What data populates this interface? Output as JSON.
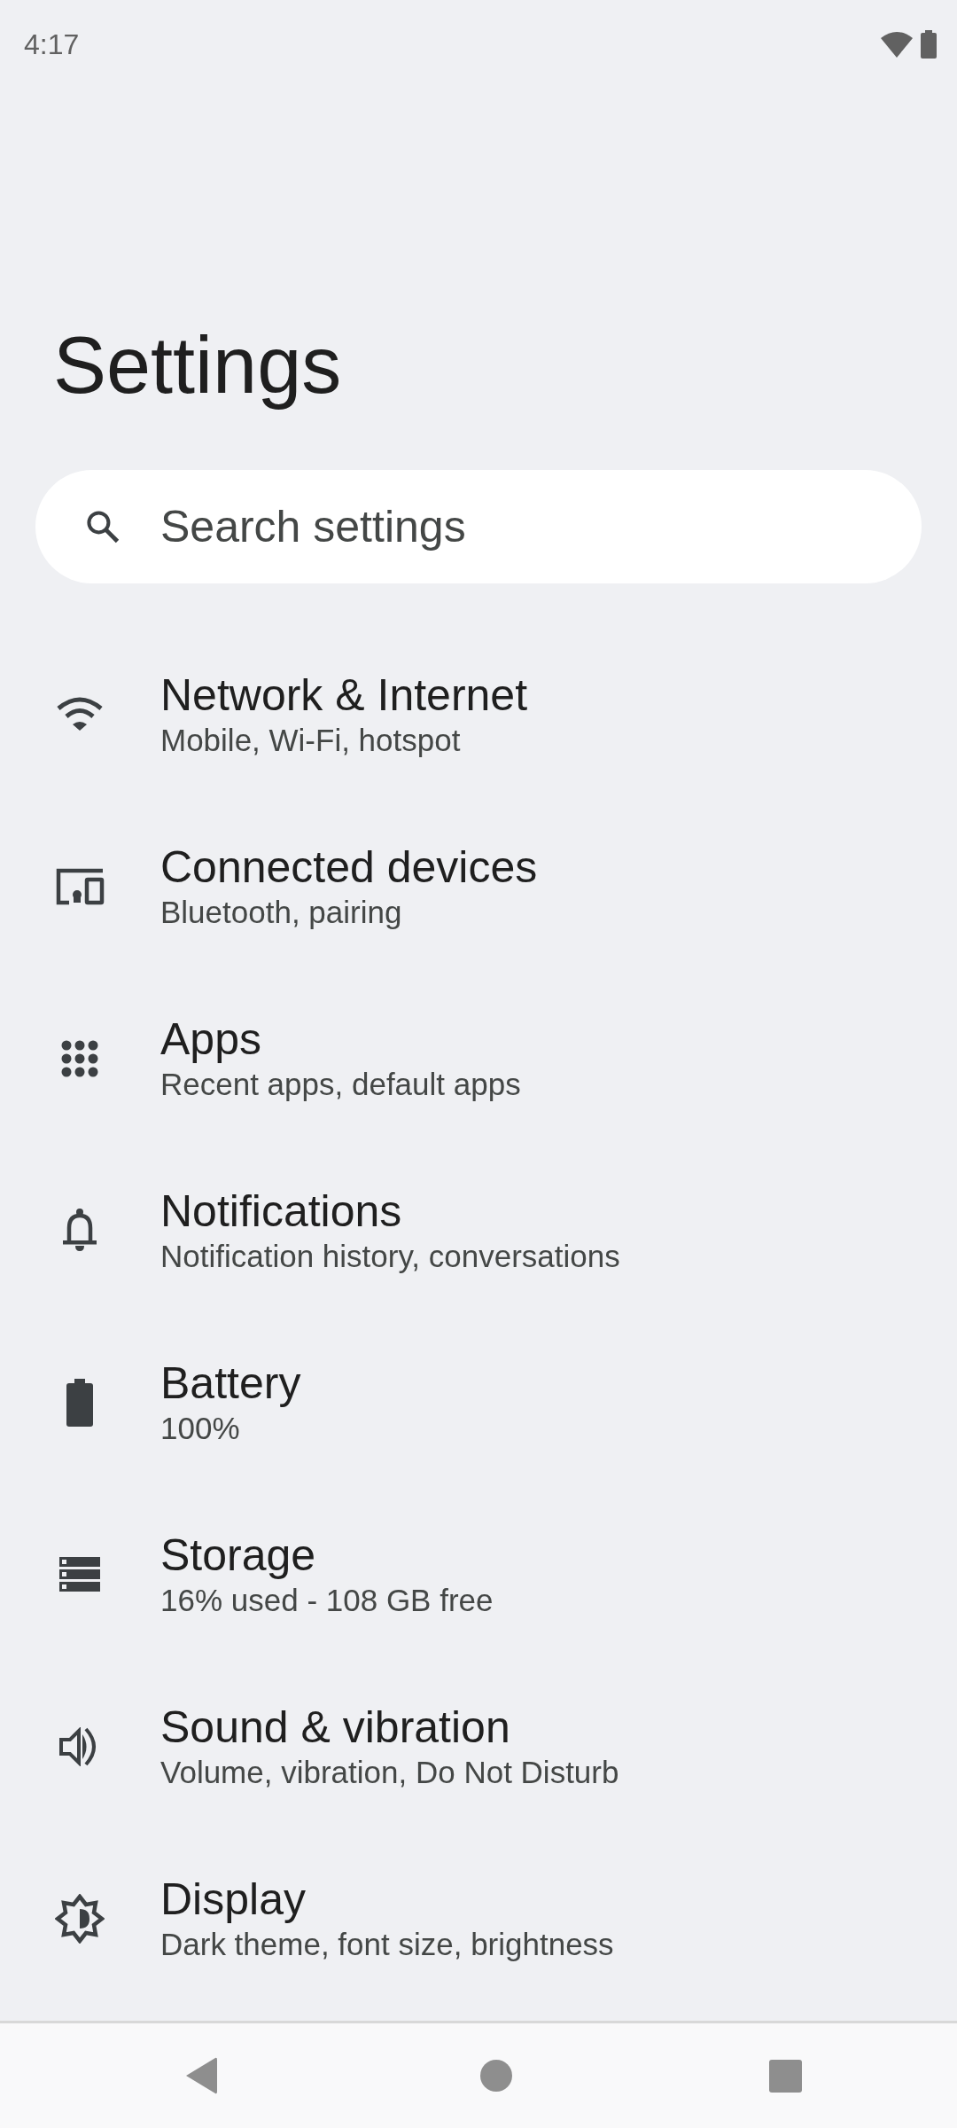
{
  "status_bar": {
    "time": "4:17"
  },
  "title": "Settings",
  "search": {
    "placeholder": "Search settings"
  },
  "items": [
    {
      "title": "Network & Internet",
      "subtitle": "Mobile, Wi-Fi, hotspot"
    },
    {
      "title": "Connected devices",
      "subtitle": "Bluetooth, pairing"
    },
    {
      "title": "Apps",
      "subtitle": "Recent apps, default apps"
    },
    {
      "title": "Notifications",
      "subtitle": "Notification history, conversations"
    },
    {
      "title": "Battery",
      "subtitle": "100%"
    },
    {
      "title": "Storage",
      "subtitle": "16% used - 108 GB free"
    },
    {
      "title": "Sound & vibration",
      "subtitle": "Volume, vibration, Do Not Disturb"
    },
    {
      "title": "Display",
      "subtitle": "Dark theme, font size, brightness"
    }
  ]
}
